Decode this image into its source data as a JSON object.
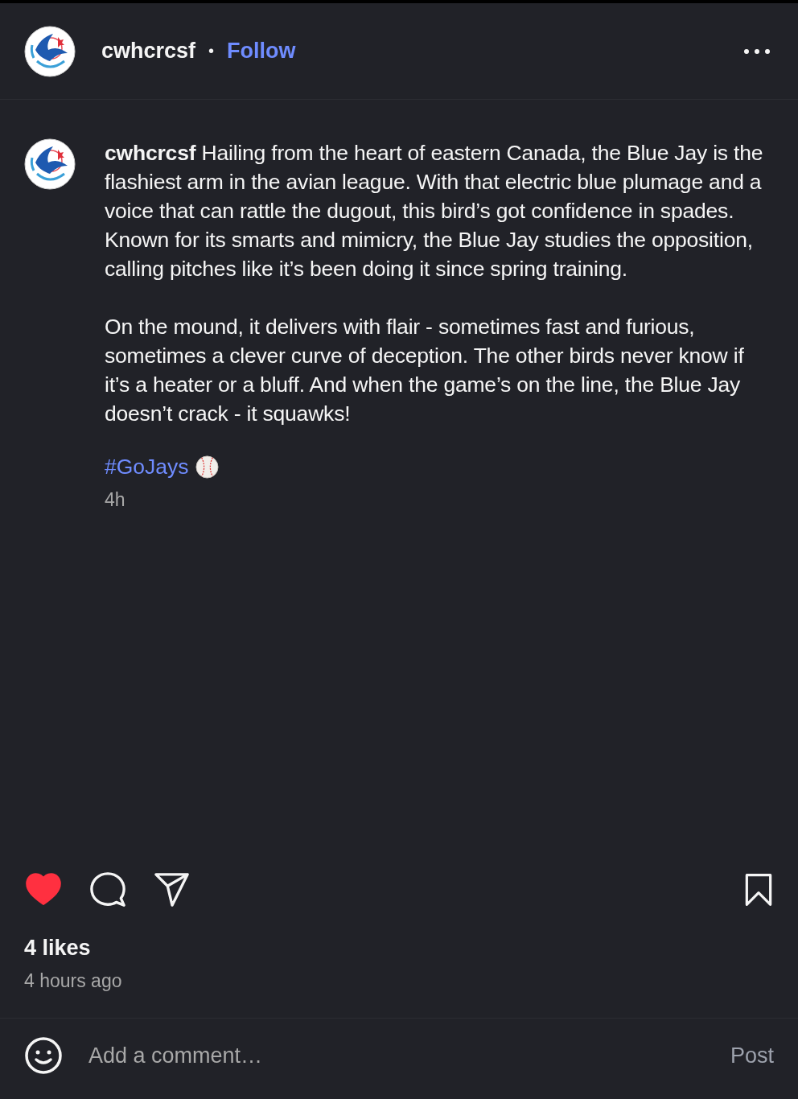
{
  "header": {
    "username": "cwhcrcsf",
    "separator": "•",
    "follow": "Follow"
  },
  "caption": {
    "username": "cwhcrcsf",
    "paragraphs": [
      "Hailing from the heart of eastern Canada, the Blue Jay is the flashiest arm in the avian league. With that electric blue plumage and a voice that can rattle the dugout, this bird’s got confidence in spades. Known for its smarts and mimicry, the Blue Jay studies the opposition, calling pitches like it’s been doing it since spring training.",
      "On the mound, it delivers with flair - sometimes fast and furious, sometimes a clever curve of deception. The other birds never know if it’s a heater or a bluff. And when the game’s on the line, the Blue Jay doesn’t crack - it squawks!"
    ],
    "hashtag": "#GoJays",
    "time": "4h"
  },
  "actions": {
    "liked": true,
    "saved": false
  },
  "likes": "4 likes",
  "posted": "4 hours ago",
  "comment": {
    "placeholder": "Add a comment…",
    "post": "Post",
    "post_disabled": true
  }
}
